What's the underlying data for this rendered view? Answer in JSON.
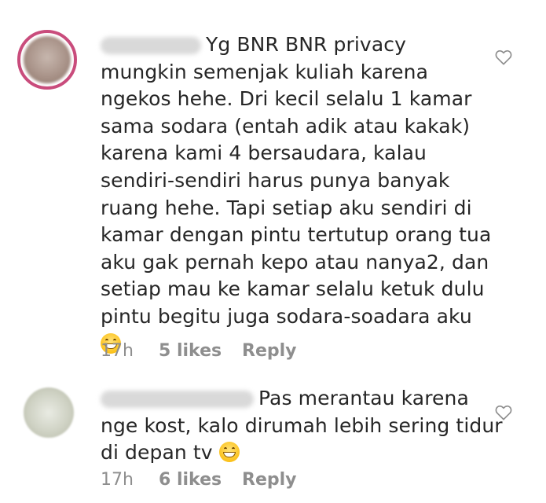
{
  "comments": [
    {
      "text": "Yg BNR BNR privacy\nmungkin semenjak kuliah karena\nngekos hehe. Dri kecil selalu 1 kamar\nsama sodara (entah adik atau kakak)\nkarena kami 4 bersaudara, kalau\nsendiri-sendiri harus punya banyak\nruang hehe. Tapi setiap aku sendiri di\nkamar dengan pintu tertutup orang tua\naku gak pernah kepo atau nanya2, dan\nsetiap mau ke kamar selalu ketuk dulu\npintu begitu juga sodara-soadara aku",
      "emoji": "grinning-face-emoji",
      "time": "17h",
      "likes": "5 likes",
      "reply": "Reply"
    },
    {
      "text": "Pas merantau karena\nnge kost, kalo dirumah lebih sering tidur\ndi depan tv",
      "emoji": "grinning-sweat-face-emoji",
      "time": "17h",
      "likes": "6 likes",
      "reply": "Reply"
    }
  ],
  "icons": {
    "like": "heart-outline-icon"
  },
  "colors": {
    "text": "#262626",
    "meta": "#8e8e8e",
    "story_ring": "#c94c7c"
  }
}
